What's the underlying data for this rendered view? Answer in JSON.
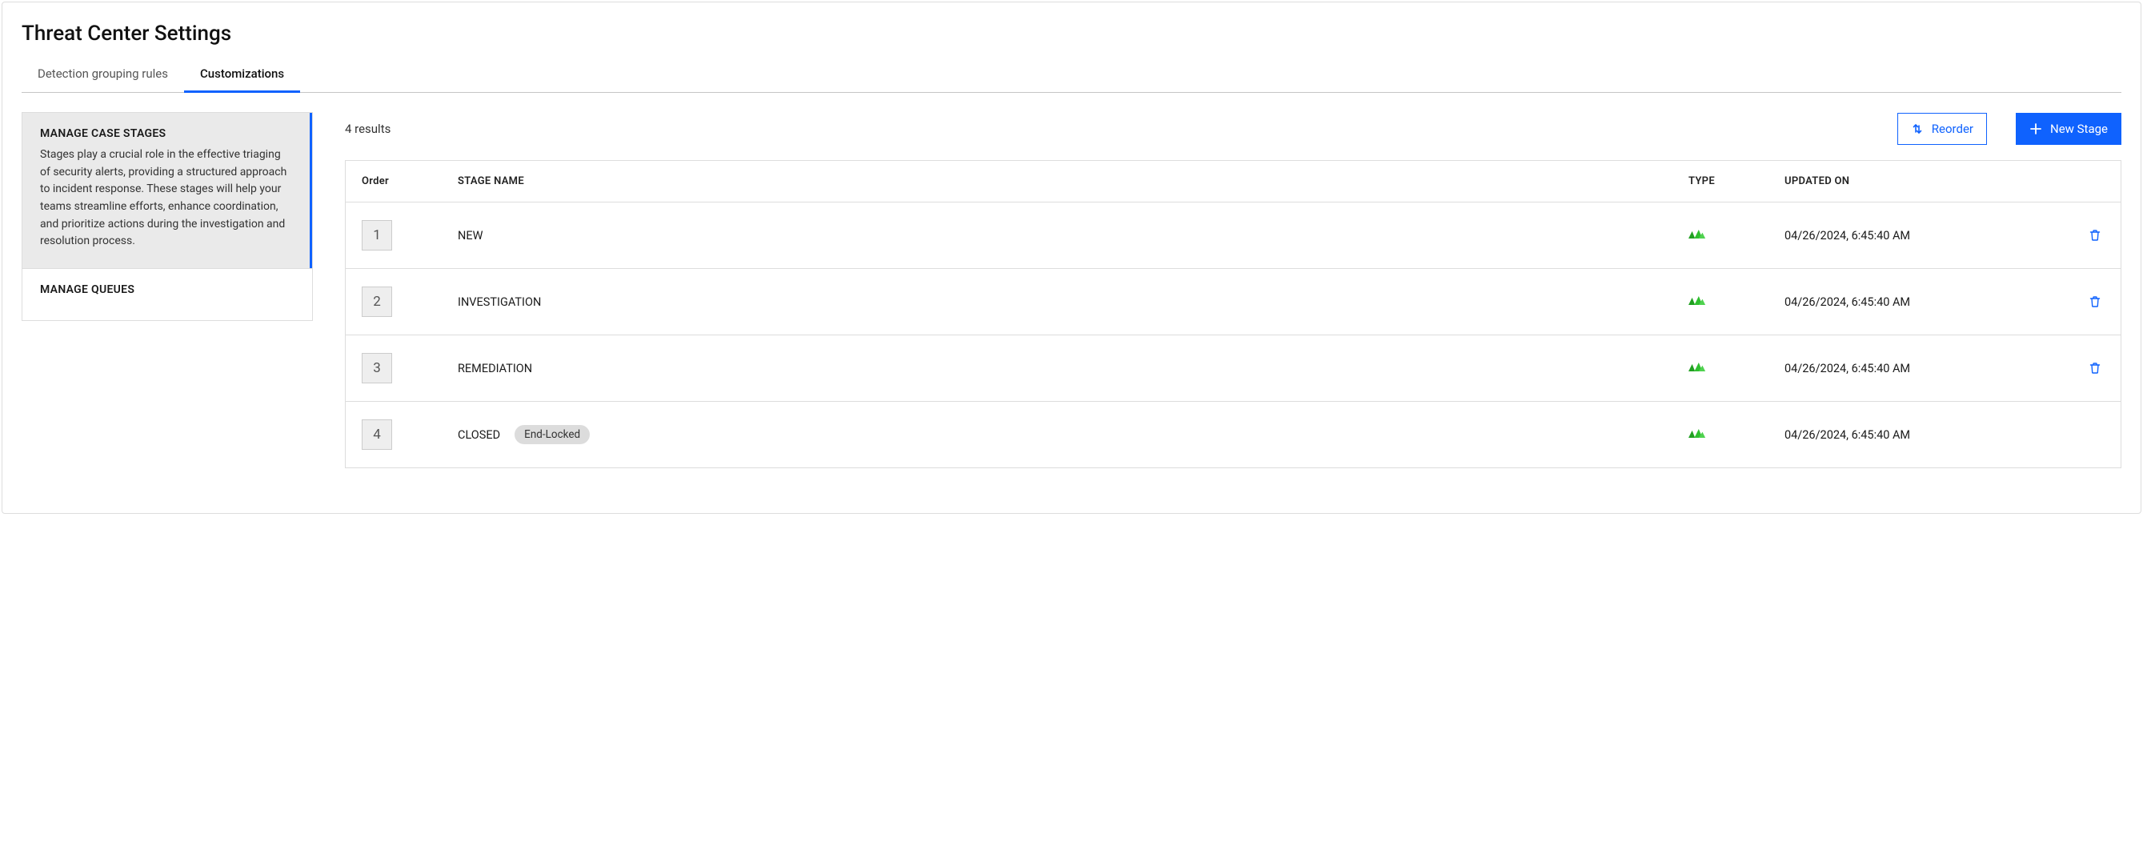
{
  "page": {
    "title": "Threat Center Settings"
  },
  "tabs": [
    {
      "id": "detection-rules",
      "label": "Detection grouping rules",
      "active": false
    },
    {
      "id": "customizations",
      "label": "Customizations",
      "active": true
    }
  ],
  "sidebar": {
    "sections": [
      {
        "id": "manage-case-stages",
        "title": "MANAGE CASE STAGES",
        "desc": "Stages play a crucial role in the effective triaging of security alerts, providing a structured approach to incident response. These stages will help your teams streamline efforts, enhance coordination, and prioritize actions during the investigation and resolution process.",
        "active": true
      },
      {
        "id": "manage-queues",
        "title": "MANAGE QUEUES",
        "desc": "",
        "active": false
      }
    ]
  },
  "toolbar": {
    "results_label": "4 results",
    "reorder_label": "Reorder",
    "new_stage_label": "New Stage"
  },
  "table": {
    "columns": {
      "order": "Order",
      "stage_name": "STAGE NAME",
      "type": "TYPE",
      "updated_on": "UPDATED ON"
    },
    "rows": [
      {
        "order": "1",
        "name": "NEW",
        "badge": "",
        "type_icon": "sumo-logic-icon",
        "updated_on": "04/26/2024, 6:45:40 AM",
        "deletable": true
      },
      {
        "order": "2",
        "name": "INVESTIGATION",
        "badge": "",
        "type_icon": "sumo-logic-icon",
        "updated_on": "04/26/2024, 6:45:40 AM",
        "deletable": true
      },
      {
        "order": "3",
        "name": "REMEDIATION",
        "badge": "",
        "type_icon": "sumo-logic-icon",
        "updated_on": "04/26/2024, 6:45:40 AM",
        "deletable": true
      },
      {
        "order": "4",
        "name": "CLOSED",
        "badge": "End-Locked",
        "type_icon": "sumo-logic-icon",
        "updated_on": "04/26/2024, 6:45:40 AM",
        "deletable": false
      }
    ]
  }
}
